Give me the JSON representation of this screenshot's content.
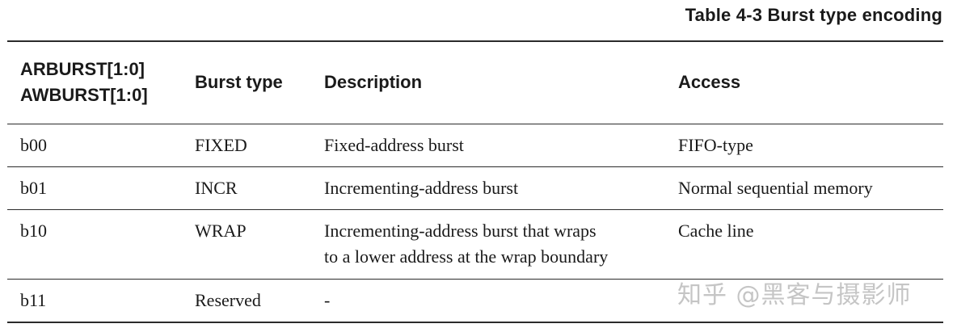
{
  "caption": "Table 4-3 Burst type encoding",
  "table": {
    "headers": {
      "col1_line1": "ARBURST[1:0]",
      "col1_line2": "AWBURST[1:0]",
      "col2": "Burst type",
      "col3": "Description",
      "col4": "Access"
    },
    "rows": [
      {
        "code": "b00",
        "type": "FIXED",
        "description_line1": "Fixed-address burst",
        "description_line2": "",
        "access": "FIFO-type"
      },
      {
        "code": "b01",
        "type": "INCR",
        "description_line1": "Incrementing-address burst",
        "description_line2": "",
        "access": "Normal sequential memory"
      },
      {
        "code": "b10",
        "type": "WRAP",
        "description_line1": "Incrementing-address burst that wraps",
        "description_line2": "to a lower address at the wrap boundary",
        "access": "Cache line"
      },
      {
        "code": "b11",
        "type": "Reserved",
        "description_line1": "-",
        "description_line2": "",
        "access": ""
      }
    ]
  },
  "watermark": "知乎 @黑客与摄影师"
}
